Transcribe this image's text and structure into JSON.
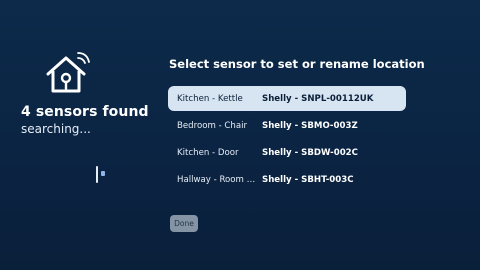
{
  "status": {
    "title": "4 sensors found",
    "subtitle": "searching..."
  },
  "main": {
    "heading": "Select sensor to set or rename location",
    "sensors": [
      {
        "location": "Kitchen - Kettle",
        "device": "Shelly - SNPL-00112UK",
        "selected": true
      },
      {
        "location": "Bedroom - Chair",
        "device": "Shelly - SBMO-003Z",
        "selected": false
      },
      {
        "location": "Kitchen - Door",
        "device": "Shelly - SBDW-002C",
        "selected": false
      },
      {
        "location": "Hallway - Room Temperature",
        "device": "Shelly - SBHT-003C",
        "selected": false
      }
    ],
    "done_label": "Done"
  },
  "icons": {
    "status_icon": "smart-home-icon",
    "spinner": "loading-spinner"
  },
  "colors": {
    "background": "#0b2443",
    "selected_row": "#d7e5f3",
    "button": "#8494a4"
  }
}
